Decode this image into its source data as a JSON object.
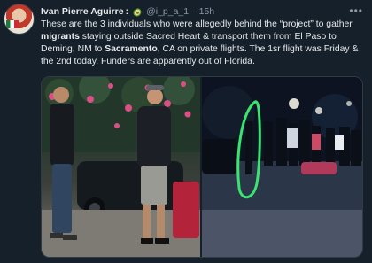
{
  "author": {
    "display_name": "Ivan Pierre Aguirre",
    "colon": ":",
    "handle": "@i_p_a_1",
    "separator": "·",
    "time": "15h"
  },
  "icons": {
    "badge": "avocado-emoji-icon",
    "more": "more-options-icon"
  },
  "tweet": {
    "text_1": "These are the 3 individuals who were allegedly behind the “project” to gather ",
    "bold_1": "migrants",
    "text_2": " staying outside Sacred Heart & transport them from El Paso to Deming, NM to ",
    "bold_2": "Sacramento",
    "text_3": ", CA on private flights. The 1sr flight was Friday & the 2nd today. Funders are apparently out of Florida."
  },
  "more_label": "•••",
  "colors": {
    "background": "#15202b",
    "text": "#e7e9ea",
    "muted": "#8b98a5",
    "highlight_circle": "#39e46f"
  }
}
